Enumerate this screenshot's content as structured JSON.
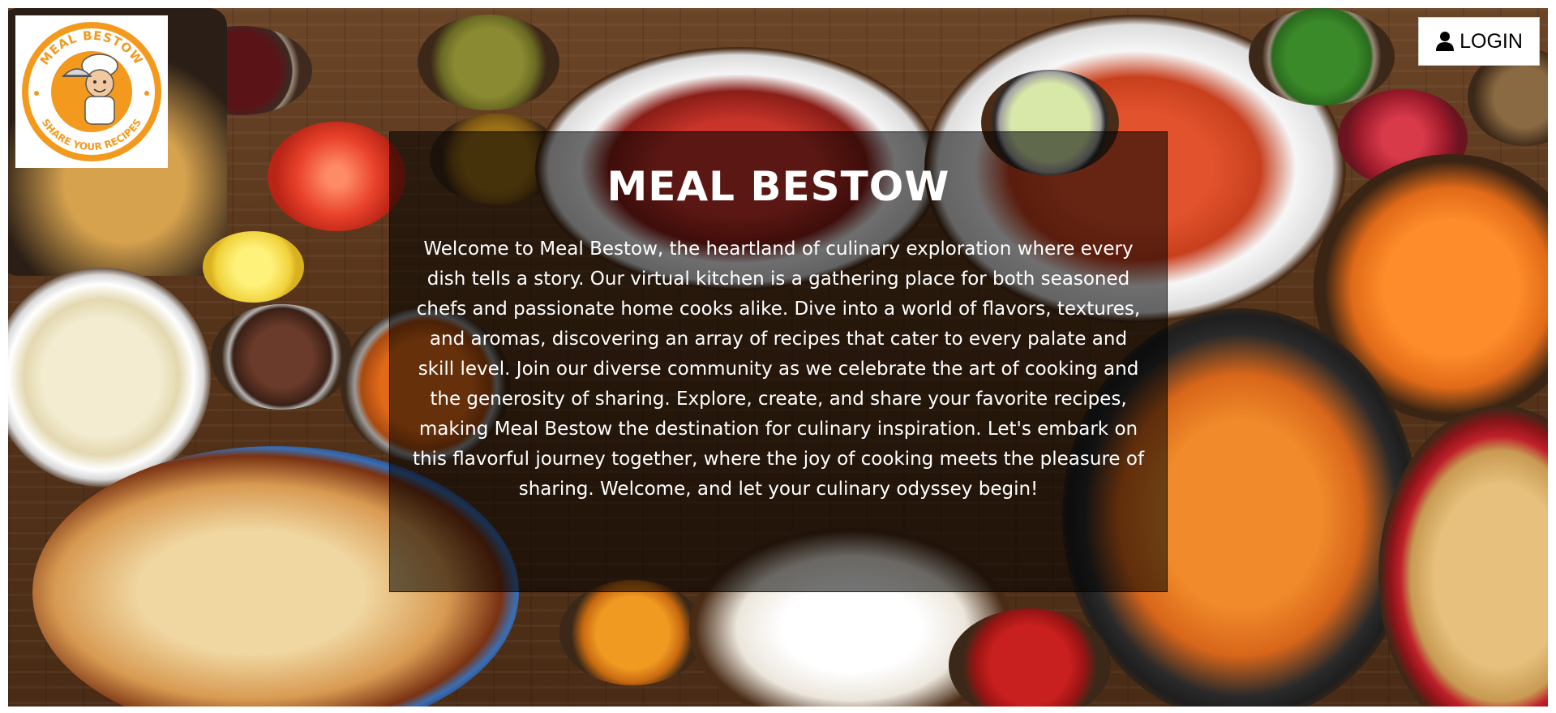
{
  "brand": {
    "logo_top_text": "MEAL BESTOW",
    "logo_bottom_text": "SHARE YOUR RECIPES"
  },
  "header": {
    "login_label": "LOGIN",
    "login_icon": "user-icon"
  },
  "hero": {
    "title": "MEAL BESTOW",
    "paragraph": "Welcome to Meal Bestow, the heartland of culinary exploration where every dish tells a story. Our virtual kitchen is a gathering place for both seasoned chefs and passionate home cooks alike. Dive into a world of flavors, textures, and aromas, discovering an array of recipes that cater to every palate and skill level. Join our diverse community as we celebrate the art of cooking and the generosity of sharing. Explore, create, and share your favorite recipes, making Meal Bestow the destination for culinary inspiration. Let's embark on this flavorful journey together, where the joy of cooking meets the pleasure of sharing. Welcome, and let your culinary odyssey begin!"
  },
  "colors": {
    "brand_orange": "#f39a1e",
    "overlay": "rgba(0,0,0,0.55)"
  }
}
